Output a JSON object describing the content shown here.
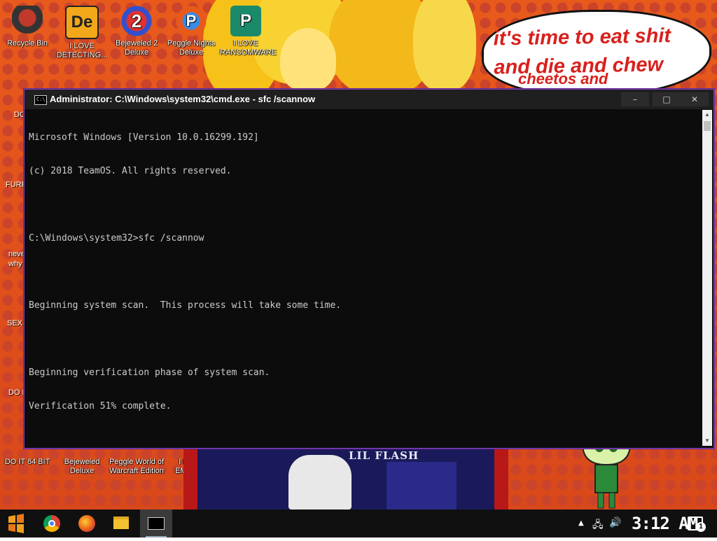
{
  "wallpaper": {
    "speech_line1": "it's time to eat shit",
    "speech_line2": "and die and chew",
    "speech_line3": "cheetos and",
    "album_label": "LIL FLASH"
  },
  "desktop_icons": [
    {
      "label": "Recycle Bin",
      "icon": "recycle-bin-icon"
    },
    {
      "label": "I LOVE DETECTING...",
      "icon": "de-app-icon"
    },
    {
      "label": "Bejeweled 2 Deluxe",
      "icon": "bejeweled-2-icon"
    },
    {
      "label": "Peggle Nights Deluxe",
      "icon": "peggle-nights-icon"
    },
    {
      "label": "I LOVE RANSOMWARE",
      "icon": "publisher-icon"
    }
  ],
  "desktop_icons_bottom": [
    {
      "label": "DO IT 64 BIT"
    },
    {
      "label": "Bejeweled Deluxe"
    },
    {
      "label": "Peggle World of Warcraft Edition"
    },
    {
      "label": "I LOVE EMOTET"
    }
  ],
  "desktop_edge_fragments": [
    "DO",
    "FURF",
    "neve",
    "why",
    "SEX",
    "DO I"
  ],
  "cmd": {
    "title": "Administrator: C:\\Windows\\system32\\cmd.exe - sfc  /scannow",
    "lines": [
      "Microsoft Windows [Version 10.0.16299.192]",
      "(c) 2018 TeamOS. All rights reserved.",
      "",
      "C:\\Windows\\system32>sfc /scannow",
      "",
      "Beginning system scan.  This process will take some time.",
      "",
      "Beginning verification phase of system scan.",
      "Verification 51% complete."
    ],
    "minimize": "–",
    "maximize": "□",
    "close": "✕"
  },
  "taskbar": {
    "apps": [
      {
        "name": "start",
        "icon": "start-icon",
        "color": "#e8941a"
      },
      {
        "name": "chrome",
        "icon": "chrome-icon",
        "color": "#2e9b4a"
      },
      {
        "name": "firefox",
        "icon": "firefox-icon",
        "color": "#e86a1a"
      },
      {
        "name": "file-explorer",
        "icon": "folder-icon",
        "color": "#f2c230"
      },
      {
        "name": "cmd",
        "icon": "cmd-icon",
        "color": "#000000"
      }
    ],
    "clock": "3:12 AM",
    "notifications": "1"
  }
}
